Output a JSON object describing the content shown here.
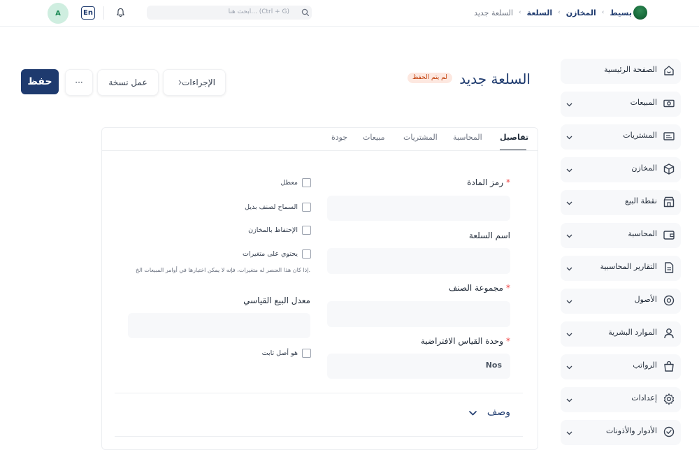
{
  "topbar": {
    "app_name": "بسيط",
    "breadcrumbs": [
      "المخازن",
      "السلعة",
      "السلعة جديد"
    ],
    "search_placeholder": "ابحث هنا... (Ctrl + G)",
    "language": "En",
    "avatar_initial": "A"
  },
  "sidebar": {
    "items": [
      {
        "label": "الصفحة الرئيسية",
        "icon": "home-icon"
      },
      {
        "label": "المبيعات",
        "icon": "money-icon"
      },
      {
        "label": "المشتريات",
        "icon": "receipt-icon"
      },
      {
        "label": "المخازن",
        "icon": "box-icon"
      },
      {
        "label": "نقطة البيع",
        "icon": "store-icon"
      },
      {
        "label": "المحاسبة",
        "icon": "wallet-icon"
      },
      {
        "label": "التقارير المحاسبية",
        "icon": "document-icon"
      },
      {
        "label": "الأصول",
        "icon": "target-icon"
      },
      {
        "label": "الموارد البشرية",
        "icon": "user-icon"
      },
      {
        "label": "الرواتب",
        "icon": "bag-icon"
      },
      {
        "label": "إعدادات",
        "icon": "gear-icon"
      },
      {
        "label": "الأدوار والأذونات",
        "icon": "check-circle-icon"
      }
    ]
  },
  "header": {
    "title": "السلعة جديد",
    "status_badge": "لم يتم الحفظ",
    "save_label": "حفظ",
    "more_label": "···",
    "duplicate_label": "عمل نسخة",
    "actions_label": "الإجراءات"
  },
  "tabs": [
    "تفاصيل",
    "المحاسبة",
    "المشتريات",
    "مبيعات",
    "جودة"
  ],
  "form": {
    "item_code_label": "رمز المادة",
    "item_name_label": "اسم السلعة",
    "item_group_label": "مجموعة الصنف",
    "uom_label": "وحدة القياس الافتراضية",
    "uom_value": "Nos",
    "required_mark": "*",
    "disabled_label": "معطل",
    "allow_alternative_label": "السماح لصنف بديل",
    "maintain_stock_label": "الإحتفاظ بالمخازن",
    "has_variants_label": "يحتوي على متغيرات",
    "has_variants_help": "إذا كان هذا العنصر له متغيرات، فإنه لا يمكن اختيارها في أوامر المبيعات الخ.",
    "standard_rate_label": "معدل البيع القياسي",
    "fixed_asset_label": "هو أصل ثابت",
    "description_section": "وصف"
  },
  "colors": {
    "primary": "#1e3a6e",
    "badge_bg": "#fde8e0",
    "badge_text": "#c2410c",
    "input_bg": "#f7f8fa"
  }
}
